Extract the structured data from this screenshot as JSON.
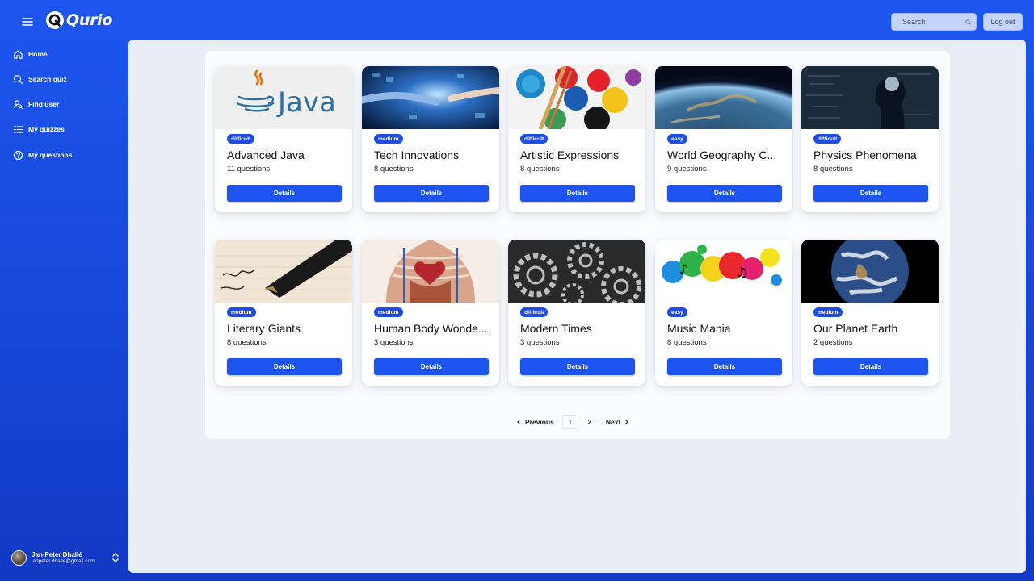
{
  "app": {
    "name": "Qurio"
  },
  "header": {
    "search_placeholder": "Search",
    "logout_label": "Log out"
  },
  "sidebar": {
    "items": [
      {
        "label": "Home",
        "icon": "home-icon"
      },
      {
        "label": "Search quiz",
        "icon": "search-icon"
      },
      {
        "label": "Find user",
        "icon": "user-search-icon"
      },
      {
        "label": "My quizzes",
        "icon": "list-icon"
      },
      {
        "label": "My questions",
        "icon": "question-circle-icon"
      }
    ]
  },
  "user": {
    "name": "Jan-Peter Dhallé",
    "email": "janpeter.dhalle@gmail.com"
  },
  "quizzes": [
    {
      "title": "Advanced Java",
      "count": "11 questions",
      "difficulty": "difficult",
      "image": "java-logo",
      "details_label": "Details"
    },
    {
      "title": "Tech Innovations",
      "count": "8 questions",
      "difficulty": "medium",
      "image": "robot-hand",
      "details_label": "Details"
    },
    {
      "title": "Artistic Expressions",
      "count": "8 questions",
      "difficulty": "difficult",
      "image": "paint-palette",
      "details_label": "Details"
    },
    {
      "title": "World Geography C...",
      "count": "9 questions",
      "difficulty": "easy",
      "image": "earth-from-space",
      "details_label": "Details"
    },
    {
      "title": "Physics Phenomena",
      "count": "8 questions",
      "difficulty": "difficult",
      "image": "head-formulas",
      "details_label": "Details"
    },
    {
      "title": "Literary Giants",
      "count": "8 questions",
      "difficulty": "medium",
      "image": "fountain-pen",
      "details_label": "Details"
    },
    {
      "title": "Human Body Wonde...",
      "count": "3 questions",
      "difficulty": "medium",
      "image": "anatomy",
      "details_label": "Details"
    },
    {
      "title": "Modern Times",
      "count": "3 questions",
      "difficulty": "difficult",
      "image": "gears",
      "details_label": "Details"
    },
    {
      "title": "Music Mania",
      "count": "8 questions",
      "difficulty": "easy",
      "image": "music-splash",
      "details_label": "Details"
    },
    {
      "title": "Our Planet Earth",
      "count": "2 questions",
      "difficulty": "medium",
      "image": "globe",
      "details_label": "Details"
    }
  ],
  "pagination": {
    "previous_label": "Previous",
    "next_label": "Next",
    "pages": [
      "1",
      "2"
    ],
    "current": "1"
  },
  "colors": {
    "primary": "#1d54f0",
    "badge": "#1d4de6",
    "background": "#e9eef6",
    "sidebar": "#1a4fe0"
  }
}
